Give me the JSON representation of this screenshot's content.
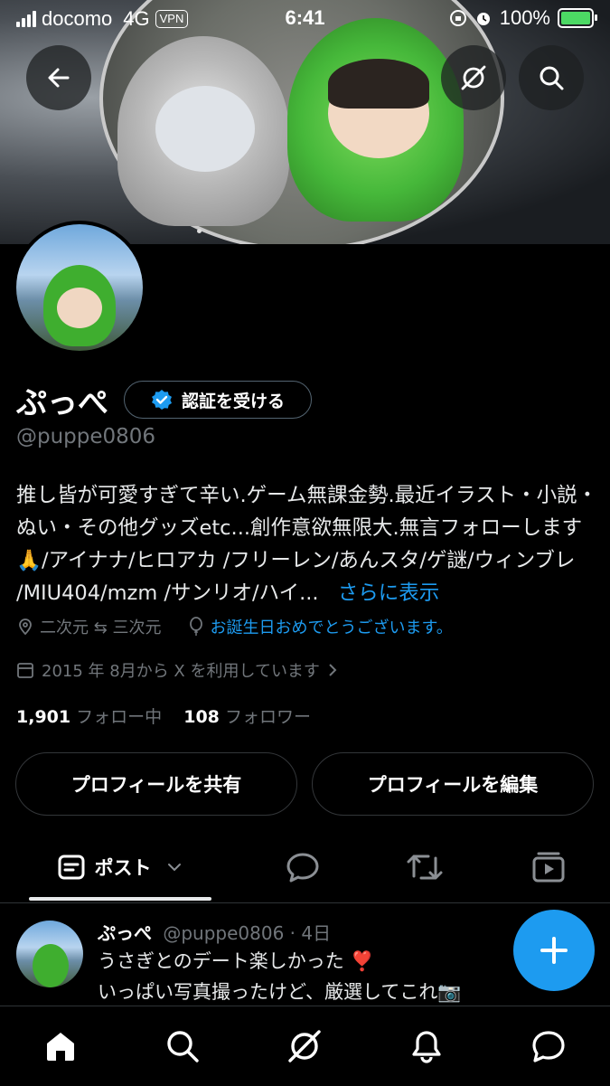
{
  "status_bar": {
    "carrier": "docomo",
    "network": "4G",
    "vpn": "VPN",
    "time": "6:41",
    "battery": "100%"
  },
  "header": {
    "back_icon": "arrow-left-icon",
    "grok_icon": "grok-icon",
    "search_icon": "search-icon"
  },
  "profile": {
    "name": "ぷっぺ",
    "verify_label": "認証を受ける",
    "handle": "@puppe0806",
    "bio": "推し皆が可愛すぎて辛い.ゲーム無課金勢.最近イラスト・小説・ぬい・その他グッズetc...創作意欲無限大.無言フォローします🙏/アイナナ/ヒロアカ /フリーレン/あんスタ/ゲ謎/ウィンブレ /MIU404/mzm /サンリオ/ハイ...",
    "bio_more": "さらに表示",
    "location": "二次元 ⇆ 三次元",
    "birthday": "お誕生日おめでとうございます。",
    "joined": "2015 年 8月から X を利用しています",
    "following_count": "1,901",
    "following_label": "フォロー中",
    "followers_count": "108",
    "followers_label": "フォロワー",
    "share_label": "プロフィールを共有",
    "edit_label": "プロフィールを編集"
  },
  "tabs": {
    "active_label": "ポスト"
  },
  "post": {
    "name": "ぷっぺ",
    "meta": "@puppe0806 · 4日",
    "line1": "うさぎとのデート楽しかった ❣️",
    "line2": "いっぱい写真撮ったけど、厳選してこれ📷"
  },
  "colors": {
    "accent": "#1d9bf0",
    "muted": "#71767b",
    "background": "#000000"
  }
}
